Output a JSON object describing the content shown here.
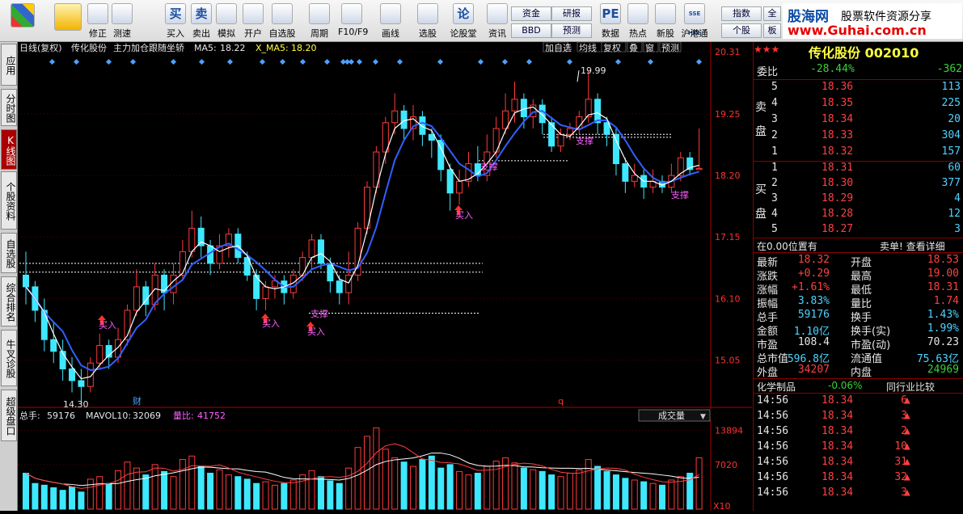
{
  "toolbar": {
    "buttons": [
      {
        "label": "",
        "icon": "home-icon"
      },
      {
        "label": "",
        "icon": "back-arrow-icon"
      },
      {
        "label": "修正",
        "icon": "up-down-icon"
      },
      {
        "label": "测速",
        "icon": "speed-icon"
      },
      {
        "label": "买入",
        "icon": "buy-icon",
        "glyph": "买"
      },
      {
        "label": "卖出",
        "icon": "sell-icon",
        "glyph": "卖"
      },
      {
        "label": "模拟",
        "icon": "hammer-icon"
      },
      {
        "label": "开户",
        "icon": "lock-icon"
      },
      {
        "label": "自选股",
        "icon": "star-icon"
      },
      {
        "label": "周期",
        "icon": "clock-icon"
      },
      {
        "label": "F10/F9",
        "icon": "f10-icon"
      },
      {
        "label": "画线",
        "icon": "pen-icon"
      },
      {
        "label": "选股",
        "icon": "filter-icon"
      },
      {
        "label": "论股堂",
        "icon": "forum-icon",
        "glyph": "论"
      },
      {
        "label": "资讯",
        "icon": "info-icon"
      },
      {
        "label": "数据",
        "icon": "pe-icon",
        "glyph": "PE"
      },
      {
        "label": "热点",
        "icon": "fire-icon"
      },
      {
        "label": "新股",
        "icon": "newstock-icon"
      },
      {
        "label": "沪港通",
        "icon": "hk-icon",
        "glyph": "SSE HKE"
      }
    ],
    "small_buttons": {
      "fund": "资金",
      "research": "研报",
      "bbd": "BBD",
      "forecast": "预测",
      "index": "指数",
      "individual": "个股",
      "all": "全",
      "board": "板"
    }
  },
  "brand": {
    "site": "股海网",
    "slogan": "股票软件资源分享",
    "url": "www.Guhai.com.cn"
  },
  "sidetabs": [
    "应用",
    "分时图",
    "K线图",
    "个股资料",
    "自选股",
    "综合排名",
    "牛叉诊股",
    "超级盘口"
  ],
  "chart_header": {
    "period": "日线(复权)",
    "stock": "传化股份",
    "indicator": "主力加仓跟随坐轿",
    "ma5_label": "MA5:",
    "ma5_value": "18.22",
    "xma5_label": "X_MA5:",
    "xma5_value": "18.20",
    "right_buttons": [
      "加自选",
      "均线",
      "复权",
      "叠",
      "窗",
      "预测"
    ]
  },
  "price_axis": [
    "20.31",
    "19.25",
    "18.20",
    "17.15",
    "16.10",
    "15.05"
  ],
  "volume_header": {
    "total_label": "总手:",
    "total": "59176",
    "mavol_label": "MAVOL10:",
    "mavol": "32069",
    "ratio_label": "量比:",
    "ratio": "41752",
    "dropdown": "成交量"
  },
  "volume_axis": [
    "13894",
    "7020",
    "X10"
  ],
  "annotations": {
    "high": "19.99",
    "low": "14.30",
    "buy": "买入",
    "support": "支撑",
    "cai": "财",
    "q": "q"
  },
  "quote": {
    "title": "传化股份 002010",
    "weibi_label": "委比",
    "weibi_pct": "-28.44%",
    "weibi_diff": "-362",
    "sell_label": "卖盘",
    "buy_label": "买盘",
    "asks": [
      {
        "lvl": "5",
        "price": "18.36",
        "vol": "113"
      },
      {
        "lvl": "4",
        "price": "18.35",
        "vol": "225"
      },
      {
        "lvl": "3",
        "price": "18.34",
        "vol": "20"
      },
      {
        "lvl": "2",
        "price": "18.33",
        "vol": "304"
      },
      {
        "lvl": "1",
        "price": "18.32",
        "vol": "157"
      }
    ],
    "bids": [
      {
        "lvl": "1",
        "price": "18.31",
        "vol": "60"
      },
      {
        "lvl": "2",
        "price": "18.30",
        "vol": "377"
      },
      {
        "lvl": "3",
        "price": "18.29",
        "vol": "4"
      },
      {
        "lvl": "4",
        "price": "18.28",
        "vol": "12"
      },
      {
        "lvl": "5",
        "price": "18.27",
        "vol": "3"
      }
    ],
    "pos_text": "在0.00位置有",
    "sell_detail": "卖单! 查看详细",
    "stats": [
      {
        "l1": "最新",
        "v1": "18.32",
        "c1": "red",
        "l2": "开盘",
        "v2": "18.53",
        "c2": "red"
      },
      {
        "l1": "涨跌",
        "v1": "+0.29",
        "c1": "red",
        "l2": "最高",
        "v2": "19.00",
        "c2": "red"
      },
      {
        "l1": "涨幅",
        "v1": "+1.61%",
        "c1": "red",
        "l2": "最低",
        "v2": "18.31",
        "c2": "red"
      },
      {
        "l1": "振幅",
        "v1": "3.83%",
        "c1": "cyan",
        "l2": "量比",
        "v2": "1.74",
        "c2": "red"
      },
      {
        "l1": "总手",
        "v1": "59176",
        "c1": "cyan",
        "l2": "换手",
        "v2": "1.43%",
        "c2": "cyan"
      },
      {
        "l1": "金额",
        "v1": "1.10亿",
        "c1": "cyan",
        "l2": "换手(实)",
        "v2": "1.99%",
        "c2": "cyan"
      },
      {
        "l1": "市盈",
        "v1": "108.4",
        "c1": "white",
        "l2": "市盈(动)",
        "v2": "70.23",
        "c2": "white"
      },
      {
        "l1": "总市值",
        "v1": "596.8亿",
        "c1": "cyan",
        "l2": "流通值",
        "v2": "75.63亿",
        "c2": "cyan"
      },
      {
        "l1": "外盘",
        "v1": "34207",
        "c1": "red",
        "l2": "内盘",
        "v2": "24969",
        "c2": "green"
      }
    ],
    "sector": "化学制品",
    "sector_pct": "-0.06%",
    "compare": "同行业比较",
    "ticks": [
      {
        "t": "14:56",
        "p": "18.34",
        "v": "6"
      },
      {
        "t": "14:56",
        "p": "18.34",
        "v": "3"
      },
      {
        "t": "14:56",
        "p": "18.34",
        "v": "2"
      },
      {
        "t": "14:56",
        "p": "18.34",
        "v": "10"
      },
      {
        "t": "14:56",
        "p": "18.34",
        "v": "31"
      },
      {
        "t": "14:56",
        "p": "18.34",
        "v": "32"
      },
      {
        "t": "14:56",
        "p": "18.34",
        "v": "3"
      }
    ]
  },
  "colors": {
    "up": "#ff3a3a",
    "down": "#3ee8ff",
    "ma5": "#ffffff",
    "ma_blue": "#3060ff",
    "support_line": "#ffffff",
    "buy_text": "#ff60ff"
  },
  "chart_data": {
    "type": "candlestick",
    "ylim": [
      14.3,
      20.31
    ],
    "candles": [
      [
        16.5,
        16.3,
        16.9,
        16.0
      ],
      [
        16.3,
        15.9,
        16.4,
        15.7
      ],
      [
        15.9,
        15.4,
        16.1,
        15.2
      ],
      [
        15.4,
        15.2,
        15.7,
        15.0
      ],
      [
        15.2,
        14.9,
        15.4,
        14.7
      ],
      [
        14.9,
        14.7,
        15.1,
        14.5
      ],
      [
        14.7,
        14.6,
        14.9,
        14.3
      ],
      [
        14.6,
        15.0,
        15.1,
        14.5
      ],
      [
        15.0,
        15.3,
        15.5,
        14.9
      ],
      [
        15.3,
        15.1,
        15.4,
        14.9
      ],
      [
        15.1,
        15.4,
        15.6,
        15.0
      ],
      [
        15.4,
        15.9,
        16.0,
        15.3
      ],
      [
        15.9,
        16.3,
        16.6,
        15.8
      ],
      [
        16.3,
        16.0,
        16.4,
        15.8
      ],
      [
        16.0,
        16.5,
        16.7,
        15.9
      ],
      [
        16.5,
        16.2,
        16.6,
        15.9
      ],
      [
        16.2,
        16.5,
        16.7,
        16.0
      ],
      [
        16.5,
        16.9,
        17.1,
        16.4
      ],
      [
        16.9,
        17.3,
        17.6,
        16.8
      ],
      [
        17.3,
        17.0,
        17.5,
        16.8
      ],
      [
        17.0,
        16.7,
        17.1,
        16.5
      ],
      [
        16.7,
        17.0,
        17.2,
        16.6
      ],
      [
        17.0,
        17.2,
        17.3,
        16.8
      ],
      [
        17.2,
        16.8,
        17.3,
        16.7
      ],
      [
        16.8,
        16.5,
        16.9,
        16.4
      ],
      [
        16.5,
        16.1,
        16.6,
        15.9
      ],
      [
        16.1,
        16.3,
        16.4,
        15.9
      ],
      [
        16.3,
        16.4,
        16.5,
        16.1
      ],
      [
        16.4,
        16.2,
        16.5,
        16.0
      ],
      [
        16.2,
        16.5,
        16.6,
        16.1
      ],
      [
        16.5,
        16.8,
        16.9,
        16.4
      ],
      [
        16.8,
        17.1,
        17.2,
        16.6
      ],
      [
        17.1,
        16.7,
        17.2,
        16.6
      ],
      [
        16.7,
        16.4,
        16.8,
        16.2
      ],
      [
        16.4,
        16.2,
        16.5,
        16.0
      ],
      [
        16.2,
        16.5,
        16.9,
        16.0
      ],
      [
        16.5,
        17.3,
        17.4,
        16.4
      ],
      [
        17.3,
        18.0,
        18.1,
        17.2
      ],
      [
        18.0,
        18.6,
        18.7,
        17.9
      ],
      [
        18.6,
        19.1,
        19.2,
        18.4
      ],
      [
        19.1,
        19.3,
        19.6,
        18.9
      ],
      [
        19.3,
        19.0,
        19.4,
        18.8
      ],
      [
        19.0,
        19.2,
        19.4,
        18.8
      ],
      [
        19.2,
        18.9,
        19.3,
        18.7
      ],
      [
        18.9,
        18.8,
        19.0,
        18.5
      ],
      [
        18.8,
        18.3,
        18.9,
        18.1
      ],
      [
        18.3,
        17.9,
        18.4,
        17.6
      ],
      [
        17.9,
        18.1,
        18.3,
        17.7
      ],
      [
        18.1,
        18.4,
        18.6,
        18.0
      ],
      [
        18.4,
        18.2,
        18.7,
        18.1
      ],
      [
        18.2,
        18.6,
        18.9,
        18.1
      ],
      [
        18.6,
        19.0,
        19.2,
        18.5
      ],
      [
        19.0,
        19.3,
        19.6,
        18.9
      ],
      [
        19.3,
        19.5,
        19.8,
        19.1
      ],
      [
        19.5,
        19.2,
        19.6,
        19.0
      ],
      [
        19.2,
        19.4,
        19.5,
        19.0
      ],
      [
        19.4,
        19.1,
        19.5,
        18.9
      ],
      [
        19.1,
        18.7,
        19.2,
        18.6
      ],
      [
        18.7,
        18.9,
        19.0,
        18.6
      ],
      [
        18.9,
        19.0,
        19.1,
        18.8
      ],
      [
        19.0,
        19.2,
        19.3,
        18.9
      ],
      [
        19.2,
        19.5,
        19.99,
        19.1
      ],
      [
        19.5,
        19.1,
        19.6,
        18.9
      ],
      [
        19.1,
        18.9,
        19.2,
        18.7
      ],
      [
        18.9,
        18.4,
        19.0,
        18.2
      ],
      [
        18.4,
        18.1,
        18.5,
        17.9
      ],
      [
        18.1,
        18.2,
        18.4,
        18.0
      ],
      [
        18.2,
        18.0,
        18.3,
        17.8
      ],
      [
        18.0,
        18.1,
        18.3,
        17.9
      ],
      [
        18.1,
        18.0,
        18.2,
        17.9
      ],
      [
        18.0,
        18.2,
        18.4,
        17.9
      ],
      [
        18.2,
        18.5,
        18.6,
        18.1
      ],
      [
        18.5,
        18.3,
        18.6,
        18.2
      ],
      [
        18.3,
        18.32,
        19.0,
        18.31
      ]
    ],
    "support_lines": [
      16.7,
      16.55,
      15.85,
      18.9,
      18.85,
      18.45
    ],
    "volumes": [
      42,
      30,
      28,
      25,
      22,
      26,
      20,
      35,
      38,
      30,
      45,
      55,
      48,
      40,
      52,
      44,
      38,
      58,
      62,
      50,
      42,
      46,
      40,
      38,
      35,
      30,
      32,
      28,
      30,
      34,
      40,
      45,
      38,
      33,
      30,
      48,
      72,
      85,
      95,
      70,
      60,
      55,
      50,
      58,
      62,
      48,
      52,
      44,
      40,
      42,
      50,
      56,
      60,
      54,
      48,
      46,
      44,
      40,
      38,
      42,
      46,
      58,
      50,
      44,
      40,
      36,
      34,
      32,
      30,
      28,
      34,
      38,
      42,
      60
    ]
  }
}
